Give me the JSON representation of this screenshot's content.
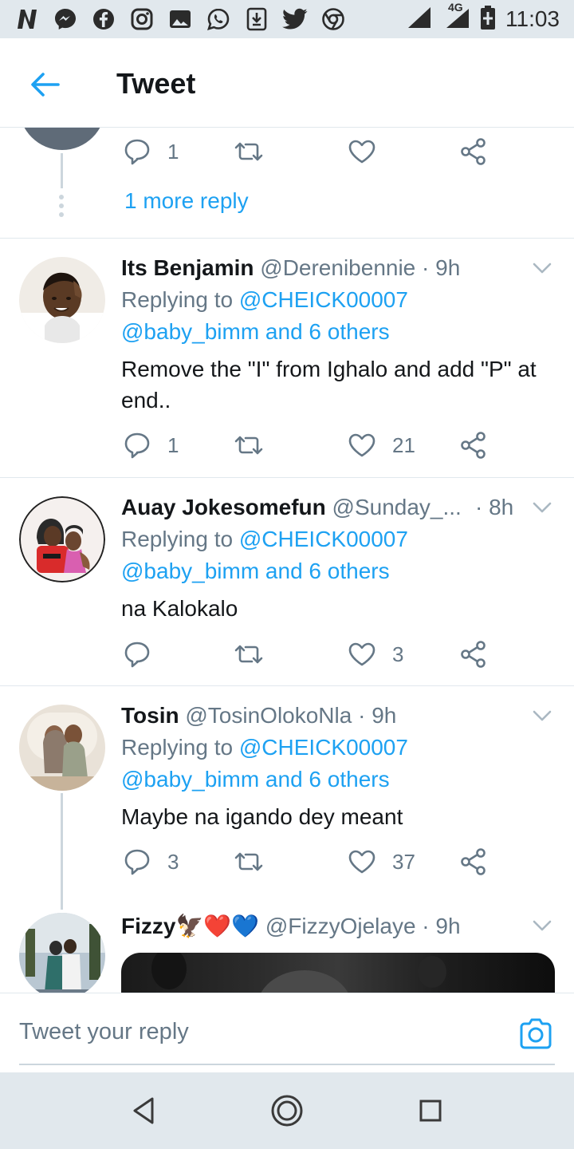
{
  "status_bar": {
    "time": "11:03",
    "network": "4G",
    "icons": [
      "n-icon",
      "messenger-icon",
      "facebook-icon",
      "instagram-icon",
      "gallery-icon",
      "whatsapp-icon",
      "download-icon",
      "twitter-icon",
      "chrome-icon"
    ]
  },
  "header": {
    "title": "Tweet",
    "back_icon": "arrow-left-icon"
  },
  "thread_top": {
    "reply_count": "1",
    "retweet_count": "",
    "like_count": "",
    "more_reply_label": "1 more reply"
  },
  "tweets": [
    {
      "name": "Its Benjamin",
      "handle": "@Derenibennie",
      "time": "· 9h",
      "replying_prefix": "Replying to",
      "replying_to": "@CHEICK00007",
      "replying_others": "@baby_bimm and 6 others",
      "text": "Remove the \"I\" from Ighalo and add \"P\" at end..",
      "reply_count": "1",
      "retweet_count": "",
      "like_count": "21"
    },
    {
      "name": "Auay Jokesomefun",
      "handle": "@Sunday_...",
      "time": "· 8h",
      "replying_prefix": "Replying to",
      "replying_to": "@CHEICK00007",
      "replying_others": "@baby_bimm and 6 others",
      "text": "na Kalokalo",
      "reply_count": "",
      "retweet_count": "",
      "like_count": "3"
    },
    {
      "name": "Tosin",
      "handle": "@TosinOlokoNla",
      "time": "· 9h",
      "replying_prefix": "Replying to",
      "replying_to": "@CHEICK00007",
      "replying_others": "@baby_bimm and 6 others",
      "text": "Maybe na igando dey meant",
      "reply_count": "3",
      "retweet_count": "",
      "like_count": "37"
    },
    {
      "name": "Fizzy🦅❤️💙",
      "handle": "@FizzyOjelaye",
      "time": "· 9h"
    }
  ],
  "compose": {
    "placeholder": "Tweet your reply",
    "camera_icon": "camera-icon"
  },
  "colors": {
    "accent": "#1da1f2",
    "secondary_text": "#657786",
    "divider": "#e1e8ed",
    "system_bar": "#e1e8ed"
  }
}
